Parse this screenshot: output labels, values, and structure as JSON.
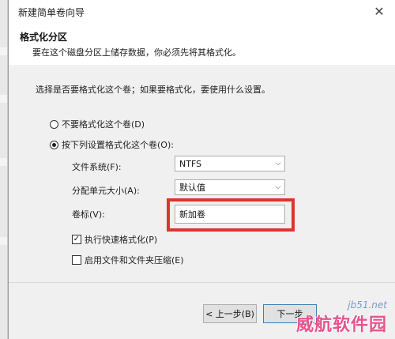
{
  "window": {
    "title": "新建简单卷向导"
  },
  "header": {
    "title": "格式化分区",
    "subtitle": "要在这个磁盘分区上储存数据，你必须先将其格式化。"
  },
  "body": {
    "instruction": "选择是否要格式化这个卷；如果要格式化，要使用什么设置。",
    "radio_no_format": "不要格式化这个卷(D)",
    "radio_format": "按下列设置格式化这个卷(O):",
    "selected_radio": "format",
    "file_system_label": "文件系统(F):",
    "file_system_value": "NTFS",
    "allocation_label": "分配单元大小(A):",
    "allocation_value": "默认值",
    "volume_label_label": "卷标(V):",
    "volume_label_value": "新加卷",
    "quick_format_label": "执行快速格式化(P)",
    "quick_format_checked": true,
    "compression_label": "启用文件和文件夹压缩(E)",
    "compression_checked": false
  },
  "footer": {
    "back_label": "< 上一步(B)",
    "next_label": "下一步"
  },
  "watermark": {
    "site": "jb51.net",
    "text": "威航软件园"
  },
  "colors": {
    "highlight_border": "#e0332b",
    "dialog_bg": "#f0f0f0",
    "watermark": "#e23a7d"
  }
}
